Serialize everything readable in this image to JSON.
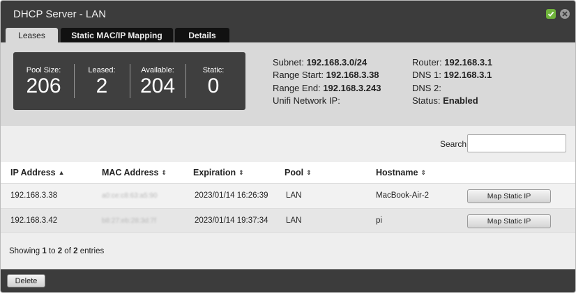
{
  "window": {
    "title": "DHCP Server - LAN",
    "accent_ok": "#6fb33b"
  },
  "tabs": [
    {
      "label": "Leases",
      "active": true
    },
    {
      "label": "Static MAC/IP Mapping",
      "active": false
    },
    {
      "label": "Details",
      "active": false
    }
  ],
  "stats": [
    {
      "label": "Pool Size:",
      "value": "206"
    },
    {
      "label": "Leased:",
      "value": "2"
    },
    {
      "label": "Available:",
      "value": "204"
    },
    {
      "label": "Static:",
      "value": "0"
    }
  ],
  "info_left": {
    "subnet_label": "Subnet:",
    "subnet_value": "192.168.3.0/24",
    "range_start_label": "Range Start:",
    "range_start_value": "192.168.3.38",
    "range_end_label": "Range End:",
    "range_end_value": "192.168.3.243",
    "unifi_label": "Unifi Network IP:"
  },
  "info_right": {
    "router_label": "Router:",
    "router_value": "192.168.3.1",
    "dns1_label": "DNS 1:",
    "dns1_value": "192.168.3.1",
    "dns2_label": "DNS 2:",
    "status_label": "Status:",
    "status_value": "Enabled"
  },
  "search": {
    "label": "Search",
    "value": ""
  },
  "table": {
    "headers": [
      "IP Address",
      "MAC Address",
      "Expiration",
      "Pool",
      "Hostname"
    ],
    "sort_active": "▲",
    "sort_idle": "⇕",
    "rows": [
      {
        "ip": "192.168.3.38",
        "mac": "a0:ce:c8:63:a5:90",
        "expiration": "2023/01/14 16:26:39",
        "pool": "LAN",
        "hostname": "MacBook-Air-2",
        "action": "Map Static IP"
      },
      {
        "ip": "192.168.3.42",
        "mac": "b8:27:eb:28:3d:7f",
        "expiration": "2023/01/14 19:37:34",
        "pool": "LAN",
        "hostname": "pi",
        "action": "Map Static IP"
      }
    ]
  },
  "pagination": {
    "prefix": "Showing ",
    "from": "1",
    "to_word": " to ",
    "to": "2",
    "of_word": " of ",
    "total": "2",
    "suffix": " entries"
  },
  "footer": {
    "delete_label": "Delete"
  }
}
